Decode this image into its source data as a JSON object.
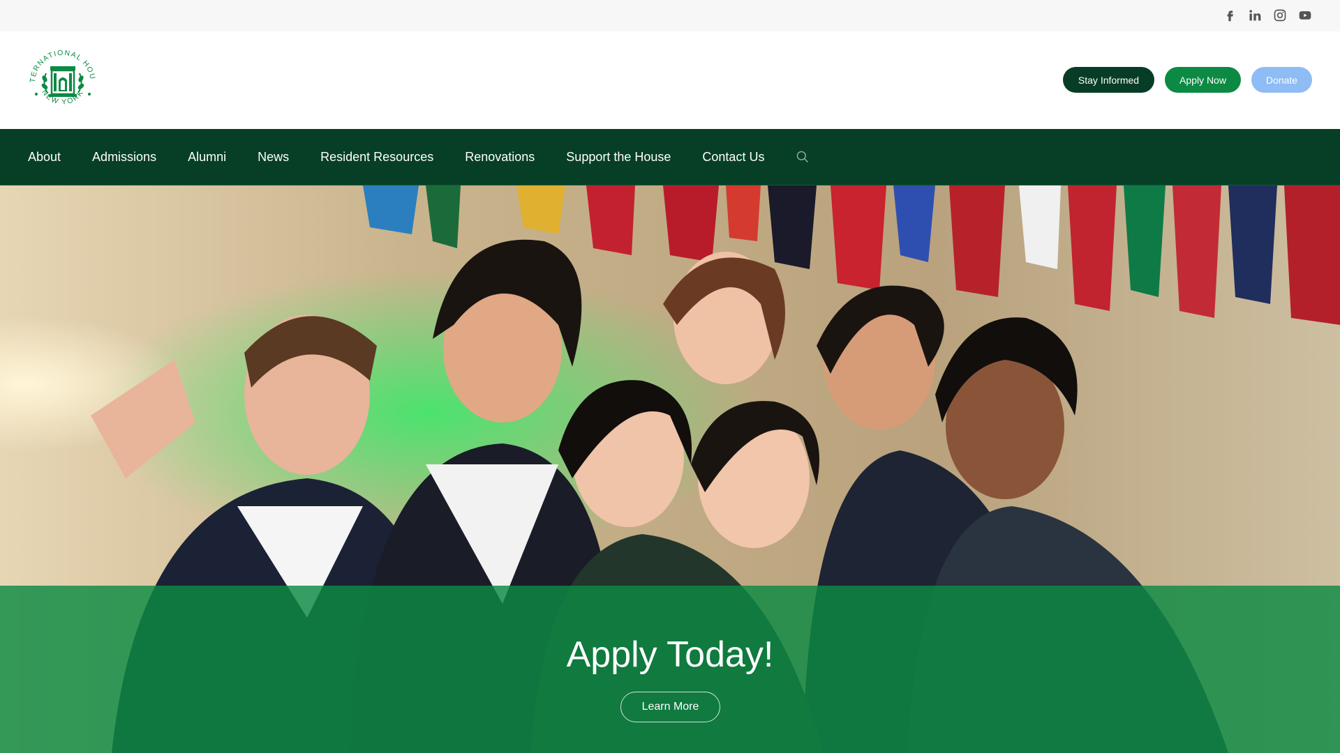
{
  "social": {
    "items": [
      {
        "icon": "facebook-icon"
      },
      {
        "icon": "linkedin-icon"
      },
      {
        "icon": "instagram-icon"
      },
      {
        "icon": "youtube-icon"
      }
    ]
  },
  "logo": {
    "top_text": "INTERNATIONAL HOUSE",
    "bottom_text": "NEW YORK",
    "color": "#0c8a43"
  },
  "header": {
    "stay_informed": "Stay Informed",
    "apply_now": "Apply Now",
    "donate": "Donate"
  },
  "nav": {
    "items": [
      {
        "label": "About"
      },
      {
        "label": "Admissions"
      },
      {
        "label": "Alumni"
      },
      {
        "label": "News"
      },
      {
        "label": "Resident Resources"
      },
      {
        "label": "Renovations"
      },
      {
        "label": "Support the House"
      },
      {
        "label": "Contact Us"
      }
    ],
    "search_icon": "search-icon"
  },
  "hero": {
    "title": "Apply Today!",
    "button": "Learn More"
  },
  "colors": {
    "nav_bg": "#063f25",
    "brand_green": "#0c8a43",
    "dark_green": "#073d26",
    "donate_blue": "#8ebcf4",
    "utility_bg": "#f7f7f7"
  }
}
